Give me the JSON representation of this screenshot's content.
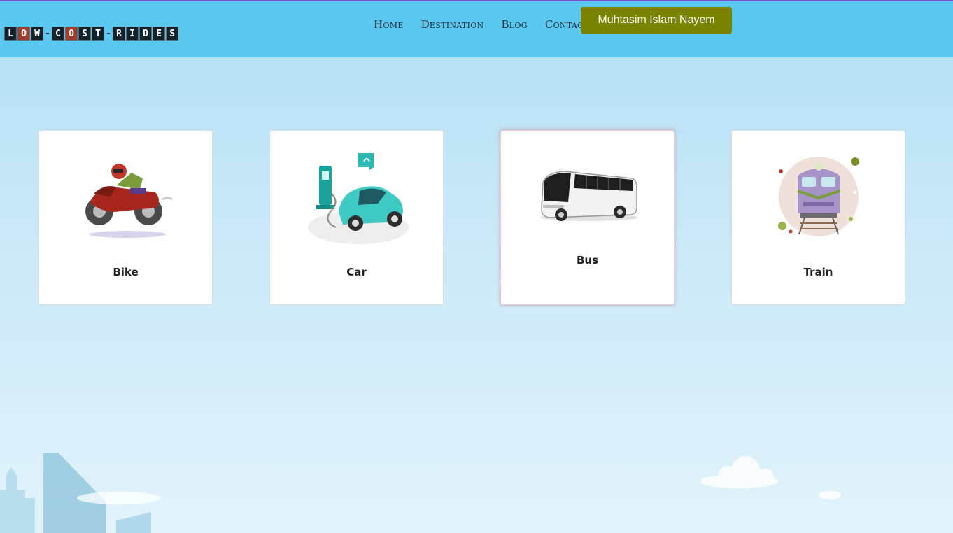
{
  "header": {
    "logo_letters": [
      "L",
      "O",
      "W",
      "-",
      "C",
      "O",
      "S",
      "T",
      "-",
      "R",
      "I",
      "D",
      "E",
      "S"
    ],
    "nav": [
      {
        "label": "Home"
      },
      {
        "label": "Destination"
      },
      {
        "label": "Blog"
      },
      {
        "label": "Contact"
      }
    ],
    "user_button": "Muhtasim Islam Nayem"
  },
  "vehicles": [
    {
      "label": "Bike",
      "icon": "motorbike-icon"
    },
    {
      "label": "Car",
      "icon": "electric-car-icon"
    },
    {
      "label": "Bus",
      "icon": "bus-icon"
    },
    {
      "label": "Train",
      "icon": "train-icon"
    }
  ],
  "colors": {
    "header_bg": "#5bc8f0",
    "button_bg": "#788401",
    "page_bg_top": "#b3dff3",
    "page_bg_bottom": "#e2f3fc"
  }
}
